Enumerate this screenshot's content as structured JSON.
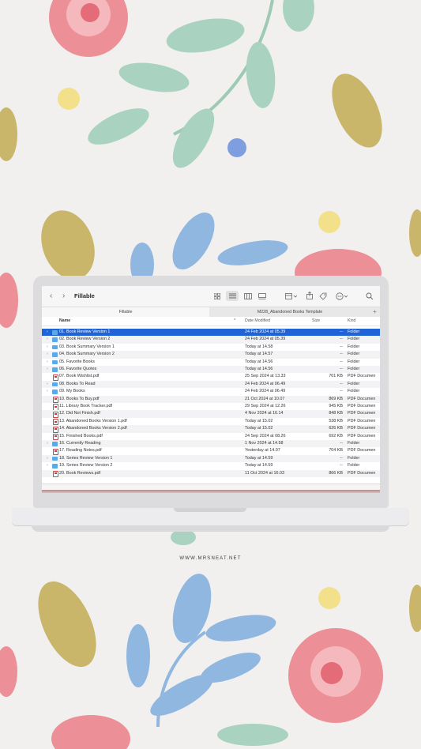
{
  "window": {
    "title": "Fillable",
    "nav_back": "‹",
    "nav_forward": "›"
  },
  "toolbar_icons": [
    "grid-view-icon",
    "list-view-icon",
    "column-view-icon",
    "gallery-view-icon",
    "group-icon",
    "share-icon",
    "tag-icon",
    "more-icon",
    "search-icon"
  ],
  "tabs": [
    {
      "label": "Fillable",
      "active": true
    },
    {
      "label": "M228_Abandoned Books Template",
      "active": false
    }
  ],
  "add_tab_label": "+",
  "columns": {
    "name": "Name",
    "date": "Date Modified",
    "size": "Size",
    "kind": "Kind",
    "sort_indicator": "^"
  },
  "rows": [
    {
      "name": "01. Book Review Version 1",
      "date": "24 Feb 2024 at 05.39",
      "size": "--",
      "kind": "Folder",
      "type": "folder",
      "selected": true
    },
    {
      "name": "02. Book Review Version 2",
      "date": "24 Feb 2024 at 05.39",
      "size": "--",
      "kind": "Folder",
      "type": "folder"
    },
    {
      "name": "03. Book Summary Version 1",
      "date": "Today at 14.58",
      "size": "--",
      "kind": "Folder",
      "type": "folder"
    },
    {
      "name": "04. Book Summary Version 2",
      "date": "Today at 14.57",
      "size": "--",
      "kind": "Folder",
      "type": "folder"
    },
    {
      "name": "05. Favorite Books",
      "date": "Today at 14.56",
      "size": "--",
      "kind": "Folder",
      "type": "folder"
    },
    {
      "name": "06. Favorite Quotes",
      "date": "Today at 14.56",
      "size": "--",
      "kind": "Folder",
      "type": "folder"
    },
    {
      "name": "07. Book Wishlist.pdf",
      "date": "25 Sep 2024 at 13.33",
      "size": "701 KB",
      "kind": "PDF Documen",
      "type": "pdf"
    },
    {
      "name": "08. Books To Read",
      "date": "24 Feb 2024 at 06.49",
      "size": "--",
      "kind": "Folder",
      "type": "folder"
    },
    {
      "name": "09. My Books",
      "date": "24 Feb 2024 at 06.49",
      "size": "--",
      "kind": "Folder",
      "type": "folder"
    },
    {
      "name": "10. Books To Buy.pdf",
      "date": "21 Oct 2024 at 10.07",
      "size": "869 KB",
      "kind": "PDF Documen",
      "type": "pdf"
    },
    {
      "name": "11. Library Book Tracker.pdf",
      "date": "29 Sep 2024 at 12.26",
      "size": "945 KB",
      "kind": "PDF Documen",
      "type": "pdf"
    },
    {
      "name": "12. Did Not Finish.pdf",
      "date": "4 Nov 2024 at 16.14",
      "size": "848 KB",
      "kind": "PDF Documen",
      "type": "pdf"
    },
    {
      "name": "13. Abandoned Books Version 1.pdf",
      "date": "Today at 15.02",
      "size": "538 KB",
      "kind": "PDF Documen",
      "type": "pdf"
    },
    {
      "name": "14. Abandoned Books Version 2.pdf",
      "date": "Today at 15.02",
      "size": "626 KB",
      "kind": "PDF Documen",
      "type": "pdf"
    },
    {
      "name": "15. Finished Books.pdf",
      "date": "24 Sep 2024 at 08.26",
      "size": "692 KB",
      "kind": "PDF Documen",
      "type": "pdf"
    },
    {
      "name": "16. Currently Reading",
      "date": "1 Nov 2024 at 14.58",
      "size": "--",
      "kind": "Folder",
      "type": "folder"
    },
    {
      "name": "17. Reading Notes.pdf",
      "date": "Yesterday at 14.07",
      "size": "704 KB",
      "kind": "PDF Documen",
      "type": "pdf"
    },
    {
      "name": "18. Series Review Version 1",
      "date": "Today at 14.59",
      "size": "--",
      "kind": "Folder",
      "type": "folder"
    },
    {
      "name": "19. Series Review Version 2",
      "date": "Today at 14.59",
      "size": "--",
      "kind": "Folder",
      "type": "folder"
    },
    {
      "name": "20. Book Reviews.pdf",
      "date": "11 Oct 2024 at 16.03",
      "size": "866 KB",
      "kind": "PDF Documen",
      "type": "pdf"
    }
  ],
  "website": "WWW.MRSNEAT.NET",
  "colors": {
    "selection": "#1f63d6",
    "folder": "#5aa9e8",
    "background": "#f1f0ee"
  }
}
